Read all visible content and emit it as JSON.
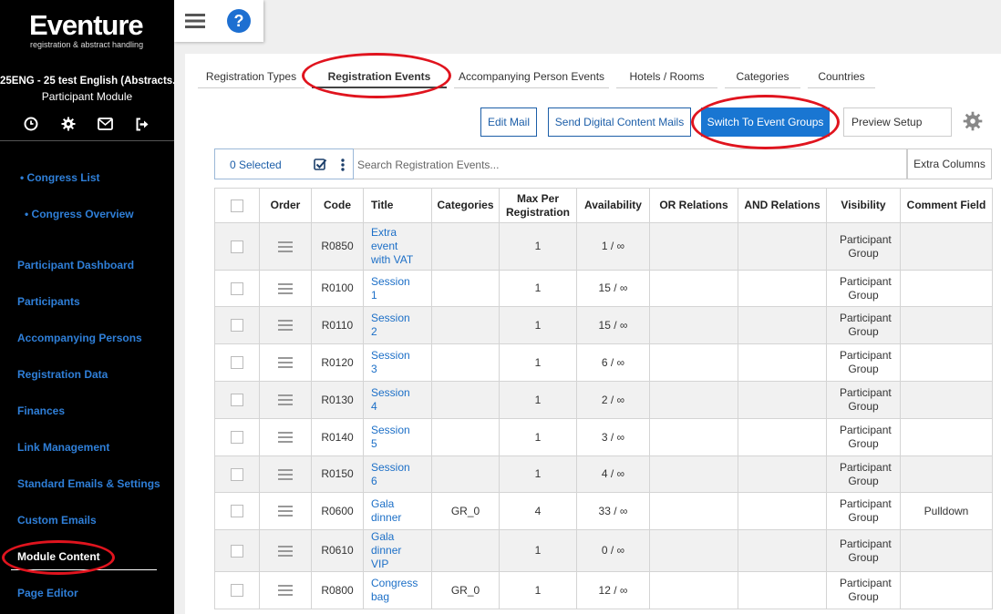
{
  "sidebar": {
    "logo_main": "Eventure",
    "logo_sub": "registration & abstract handling",
    "event_name": "25ENG - 25 test English (Abstracts...",
    "module_name": "Participant Module",
    "icons": [
      "clock-icon",
      "gear-icon",
      "mail-icon",
      "logout-icon"
    ],
    "congress_list": "• Congress List",
    "congress_overview": "• Congress Overview",
    "nav": [
      "Participant Dashboard",
      "Participants",
      "Accompanying Persons",
      "Registration Data",
      "Finances",
      "Link Management",
      "Standard Emails & Settings",
      "Custom Emails",
      "Module Content",
      "Page Editor"
    ],
    "active_item": "Module Content"
  },
  "topbar": {
    "help_label": "?"
  },
  "tabs": [
    "Registration Types",
    "Registration Events",
    "Accompanying Person Events",
    "Hotels / Rooms",
    "Categories",
    "Countries"
  ],
  "active_tab": "Registration Events",
  "toolbar": {
    "edit_mail": "Edit Mail",
    "send_digital": "Send Digital Content Mails",
    "switch_groups": "Switch To Event Groups",
    "preview_setup": "Preview Setup"
  },
  "selection": {
    "selected_label": "0 Selected"
  },
  "search": {
    "placeholder": "Search Registration Events..."
  },
  "extra_columns": "Extra Columns",
  "table": {
    "headers": [
      "",
      "Order",
      "Code",
      "Title",
      "Categories",
      "Max Per Registration",
      "Availability",
      "OR Relations",
      "AND Relations",
      "Visibility",
      "Comment Field"
    ],
    "rows": [
      {
        "code": "R0850",
        "title": "Extra event with VAT",
        "categories": "",
        "max": "1",
        "availability": "1 / ∞",
        "or": "",
        "and": "",
        "visibility": "Participant Group",
        "comment": ""
      },
      {
        "code": "R0100",
        "title": "Session 1",
        "categories": "",
        "max": "1",
        "availability": "15 / ∞",
        "or": "",
        "and": "",
        "visibility": "Participant Group",
        "comment": ""
      },
      {
        "code": "R0110",
        "title": "Session 2",
        "categories": "",
        "max": "1",
        "availability": "15 / ∞",
        "or": "",
        "and": "",
        "visibility": "Participant Group",
        "comment": ""
      },
      {
        "code": "R0120",
        "title": "Session 3",
        "categories": "",
        "max": "1",
        "availability": "6 / ∞",
        "or": "",
        "and": "",
        "visibility": "Participant Group",
        "comment": ""
      },
      {
        "code": "R0130",
        "title": "Session 4",
        "categories": "",
        "max": "1",
        "availability": "2 / ∞",
        "or": "",
        "and": "",
        "visibility": "Participant Group",
        "comment": ""
      },
      {
        "code": "R0140",
        "title": "Session 5",
        "categories": "",
        "max": "1",
        "availability": "3 / ∞",
        "or": "",
        "and": "",
        "visibility": "Participant Group",
        "comment": ""
      },
      {
        "code": "R0150",
        "title": "Session 6",
        "categories": "",
        "max": "1",
        "availability": "4 / ∞",
        "or": "",
        "and": "",
        "visibility": "Participant Group",
        "comment": ""
      },
      {
        "code": "R0600",
        "title": "Gala dinner",
        "categories": "GR_0",
        "max": "4",
        "availability": "33 / ∞",
        "or": "",
        "and": "",
        "visibility": "Participant Group",
        "comment": "Pulldown"
      },
      {
        "code": "R0610",
        "title": "Gala dinner VIP",
        "categories": "",
        "max": "1",
        "availability": "0 / ∞",
        "or": "",
        "and": "",
        "visibility": "Participant Group",
        "comment": ""
      },
      {
        "code": "R0800",
        "title": "Congress bag",
        "categories": "GR_0",
        "max": "1",
        "availability": "12 / ∞",
        "or": "",
        "and": "",
        "visibility": "Participant Group",
        "comment": ""
      }
    ]
  },
  "colors": {
    "accent": "#1976d2",
    "link": "#1c6fc7",
    "sidebar_link": "#2f7fd8",
    "annotation": "#e0141e"
  }
}
